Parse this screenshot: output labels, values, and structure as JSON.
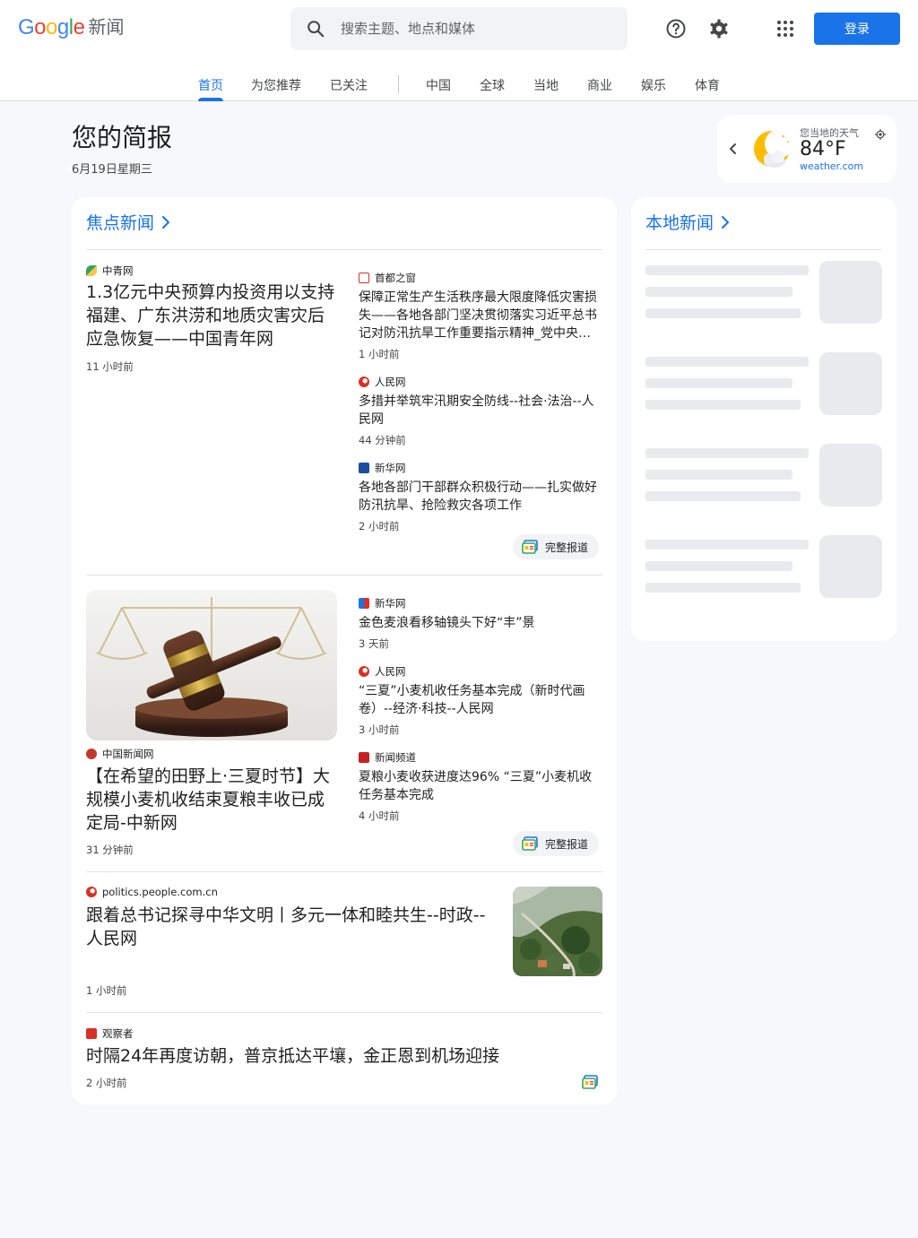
{
  "header": {
    "logo_google": "Google",
    "logo_news": "新闻",
    "search_placeholder": "搜索主题、地点和媒体",
    "signin_label": "登录"
  },
  "tabs": [
    "首页",
    "为您推荐",
    "已关注",
    "中国",
    "全球",
    "当地",
    "商业",
    "娱乐",
    "体育"
  ],
  "active_tab": "首页",
  "briefing": {
    "title": "您的简报",
    "date": "6月19日星期三"
  },
  "weather": {
    "label": "您当地的天气",
    "temp": "84°F",
    "source": "weather.com",
    "icon": "moon-cloud-icon"
  },
  "top_stories": {
    "title": "焦点新闻",
    "full_coverage_label": "完整报道",
    "cluster1": {
      "main": {
        "source": "中青网",
        "headline": "1.3亿元中央预算内投资用以支持福建、广东洪涝和地质灾害灾后应急恢复——中国青年网",
        "time": "11 小时前"
      },
      "related": [
        {
          "source": "首都之窗",
          "headline": "保障正常生产生活秩序最大限度降低灾害损失——各地各部门坚决贯彻落实习近平总书记对防汛抗旱工作重要指示精神_党中央精神在基层",
          "time": "1 小时前"
        },
        {
          "source": "人民网",
          "headline": "多措并举筑牢汛期安全防线--社会·法治--人民网",
          "time": "44 分钟前"
        },
        {
          "source": "新华网",
          "headline": "各地各部门干部群众积极行动——扎实做好防汛抗旱、抢险救灾各项工作",
          "time": "2 小时前"
        }
      ]
    },
    "cluster2": {
      "main": {
        "source": "中国新闻网",
        "headline": "【在希望的田野上·三夏时节】大规模小麦机收结束夏粮丰收已成定局-中新网",
        "time": "31 分钟前"
      },
      "related": [
        {
          "source": "新华网",
          "headline": "金色麦浪看移轴镜头下好“丰”景",
          "time": "3 天前"
        },
        {
          "source": "人民网",
          "headline": "“三夏”小麦机收任务基本完成（新时代画卷）--经济·科技--人民网",
          "time": "3 小时前"
        },
        {
          "source": "新闻频道",
          "headline": "夏粮小麦收获进度达96% “三夏”小麦机收任务基本完成",
          "time": "4 小时前"
        }
      ]
    },
    "story3": {
      "source": "politics.people.com.cn",
      "headline": "跟着总书记探寻中华文明丨多元一体和睦共生--时政--人民网",
      "time": "1 小时前"
    },
    "story4": {
      "source": "观察者",
      "headline": "时隔24年再度访朝，普京抵达平壤，金正恩到机场迎接",
      "time": "2 小时前"
    }
  },
  "local_news": {
    "title": "本地新闻"
  }
}
